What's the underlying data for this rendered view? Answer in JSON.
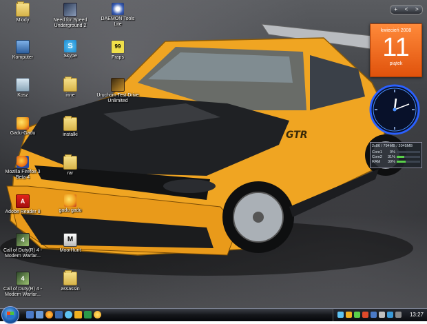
{
  "desktop_icons": [
    {
      "label": "Mlody",
      "icon": "folder-icon",
      "glyph": ""
    },
    {
      "label": "Need for Speed Underground 2",
      "icon": "nfs-icon",
      "glyph": ""
    },
    {
      "label": "DAEMON Tools Lite",
      "icon": "daemon-tools-icon",
      "glyph": ""
    },
    {
      "label": "Komputer",
      "icon": "computer-icon",
      "glyph": ""
    },
    {
      "label": "Skype",
      "icon": "skype-icon",
      "glyph": "S"
    },
    {
      "label": "Fraps",
      "icon": "fraps-icon",
      "glyph": "99"
    },
    {
      "label": "Kosz",
      "icon": "recycle-bin-icon",
      "glyph": ""
    },
    {
      "label": "inne",
      "icon": "folder-icon",
      "glyph": ""
    },
    {
      "label": "Uruchom Test Drive Unlimited",
      "icon": "game-icon",
      "glyph": ""
    },
    {
      "label": "Gadu-Gadu",
      "icon": "gadu-gadu-icon",
      "glyph": ""
    },
    {
      "label": "instalki",
      "icon": "folder-icon",
      "glyph": ""
    },
    {
      "label": "Mozilla Firefox 3 Beta 4",
      "icon": "firefox-icon",
      "glyph": ""
    },
    {
      "label": "rar",
      "icon": "folder-icon",
      "glyph": ""
    },
    {
      "label": "Adobe Reader 8",
      "icon": "adobe-reader-icon",
      "glyph": "A"
    },
    {
      "label": "gadu gadu",
      "icon": "gadu-gadu-icon",
      "glyph": ""
    },
    {
      "label": "Call of Duty(R) 4 - Modern Warfar...",
      "icon": "call-of-duty-icon",
      "glyph": "4"
    },
    {
      "label": "MoorHunt",
      "icon": "moorhunt-icon",
      "glyph": "M"
    },
    {
      "label": "Call of Duty(R) 4 - Modern Warfar...",
      "icon": "call-of-duty-icon",
      "glyph": "4"
    },
    {
      "label": "assassin",
      "icon": "folder-icon",
      "glyph": ""
    }
  ],
  "sidebar": {
    "controls": [
      "+",
      "<",
      ">"
    ],
    "calendar": {
      "month": "kwiecień 2008",
      "day": "11",
      "weekday": "piątek"
    },
    "meter": {
      "header": "2x86 / 794MB / 2045MB",
      "rows": [
        {
          "name": "Core1",
          "value": "0%",
          "level": 0
        },
        {
          "name": "Core2",
          "value": "31%",
          "level": 31
        },
        {
          "name": "RAM",
          "value": "39%",
          "level": 39
        }
      ]
    }
  },
  "taskbar": {
    "clock": "13:27",
    "car_badge": "GTR"
  }
}
